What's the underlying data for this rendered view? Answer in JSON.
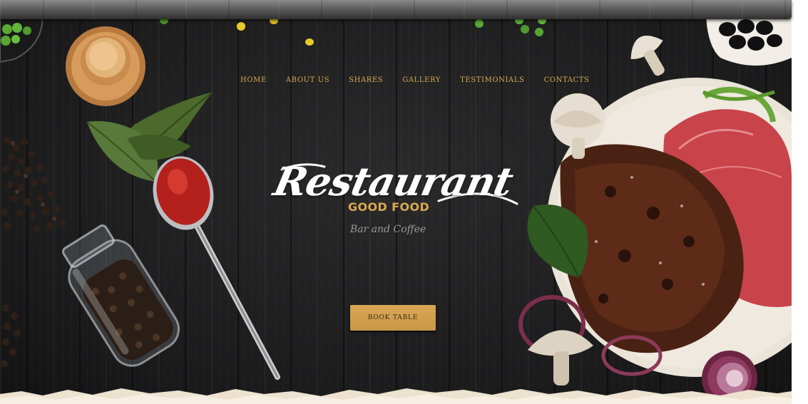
{
  "nav": {
    "items": [
      {
        "label": "HOME"
      },
      {
        "label": "ABOUT US"
      },
      {
        "label": "SHARES"
      },
      {
        "label": "GALLERY"
      },
      {
        "label": "TESTIMONIALS"
      },
      {
        "label": "CONTACTS"
      }
    ]
  },
  "hero": {
    "title": "Restaurant",
    "tagline": "GOOD FOOD",
    "subtitle": "Bar and Coffee",
    "book_button_label": "BOOK TABLE"
  },
  "colors": {
    "accent": "#d9a94f",
    "background": "#1d1d1e",
    "button": "#d3a253"
  },
  "icons": [
    "peas-icon",
    "wooden-lid-icon",
    "pepper-jar-icon",
    "spoon-icon",
    "basil-leaves-icon",
    "mushroom-icon",
    "steak-plate-icon",
    "onion-icon",
    "olives-bowl-icon"
  ]
}
